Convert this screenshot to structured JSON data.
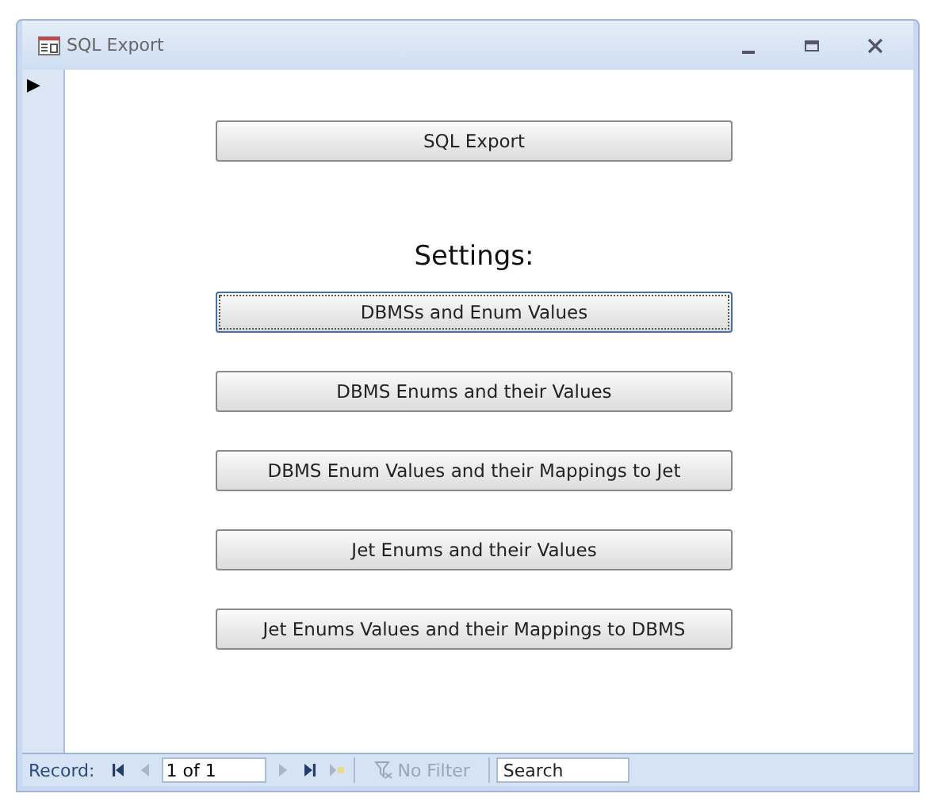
{
  "window": {
    "title": "SQL Export"
  },
  "form": {
    "record_selector": "▶",
    "main_button": {
      "label": "SQL Export",
      "focused": false
    },
    "settings_label": "Settings:",
    "settings_buttons": [
      {
        "label": "DBMSs and Enum Values",
        "focused": true
      },
      {
        "label": "DBMS Enums and their Values",
        "focused": false
      },
      {
        "label": "DBMS Enum Values and their Mappings to Jet",
        "focused": false
      },
      {
        "label": "Jet Enums and their Values",
        "focused": false
      },
      {
        "label": "Jet Enums Values and their Mappings to DBMS",
        "focused": false
      }
    ]
  },
  "status_bar": {
    "record_label": "Record:",
    "nav_buttons": [
      {
        "kind": "first",
        "disabled": false
      },
      {
        "kind": "prev",
        "disabled": true
      }
    ],
    "position": "1 of 1",
    "nav_buttons_after": [
      {
        "kind": "next",
        "disabled": true
      },
      {
        "kind": "last",
        "disabled": false
      },
      {
        "kind": "new",
        "disabled": true
      }
    ],
    "filter": {
      "label": "No Filter",
      "disabled": true
    },
    "search": {
      "placeholder": "Search"
    }
  }
}
